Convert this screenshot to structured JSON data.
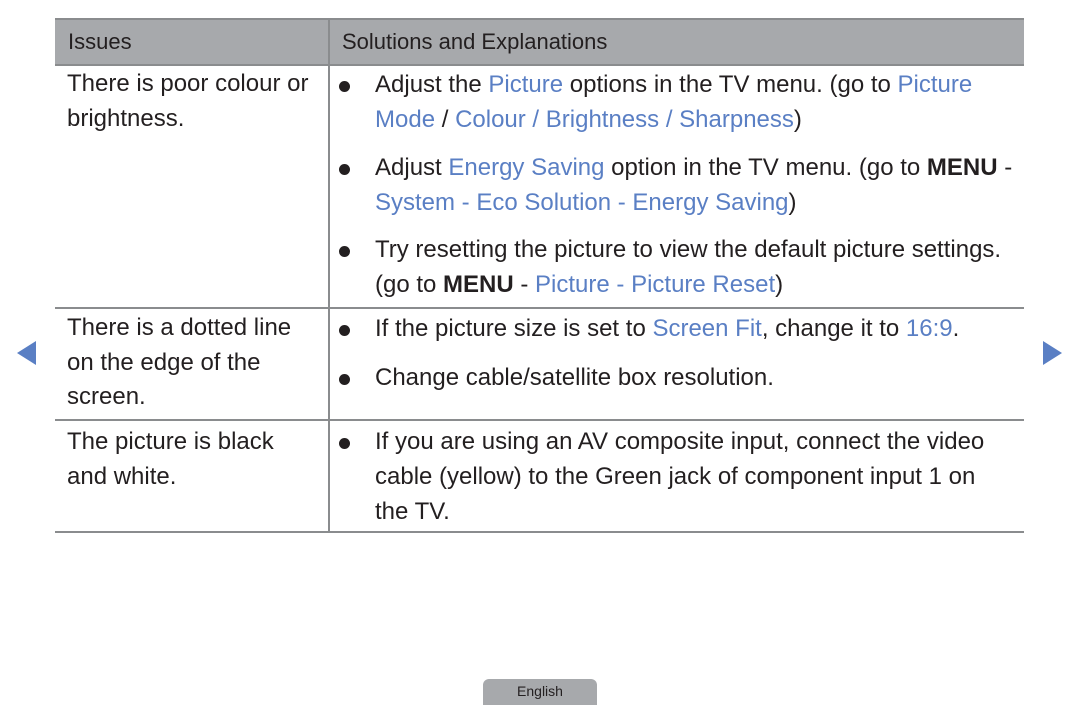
{
  "table": {
    "headers": [
      "Issues",
      "Solutions and Explanations"
    ],
    "rows": [
      {
        "issue": "There is poor colour or brightness.",
        "solutions": [
          [
            {
              "t": "Adjust the ",
              "s": "n"
            },
            {
              "t": "Picture",
              "s": "hl"
            },
            {
              "t": " options in the TV menu. (go to ",
              "s": "n"
            },
            {
              "t": "Picture Mode",
              "s": "hl"
            },
            {
              "t": " / ",
              "s": "n"
            },
            {
              "t": "Colour / Brightness / Sharpness",
              "s": "hl"
            },
            {
              "t": ")",
              "s": "n"
            }
          ],
          [
            {
              "t": "Adjust ",
              "s": "n"
            },
            {
              "t": "Energy Saving",
              "s": "hl"
            },
            {
              "t": " option in the TV menu. (go to ",
              "s": "n"
            },
            {
              "t": "MENU",
              "s": "b"
            },
            {
              "t": " - ",
              "s": "n"
            },
            {
              "t": "System - Eco Solution - Energy Saving",
              "s": "hl"
            },
            {
              "t": ")",
              "s": "n"
            }
          ],
          [
            {
              "t": "Try resetting the picture to view the default picture settings. (go to ",
              "s": "n"
            },
            {
              "t": "MENU",
              "s": "b"
            },
            {
              "t": " - ",
              "s": "n"
            },
            {
              "t": "Picture - Picture Reset",
              "s": "hl"
            },
            {
              "t": ")",
              "s": "n"
            }
          ]
        ]
      },
      {
        "issue": "There is a dotted line on the edge of the screen.",
        "solutions": [
          [
            {
              "t": "If the picture size is set to ",
              "s": "n"
            },
            {
              "t": "Screen Fit",
              "s": "hl"
            },
            {
              "t": ", change it to ",
              "s": "n"
            },
            {
              "t": "16:9",
              "s": "hl"
            },
            {
              "t": ".",
              "s": "n"
            }
          ],
          [
            {
              "t": "Change cable/satellite box resolution.",
              "s": "n"
            }
          ]
        ]
      },
      {
        "issue": "The picture is black and white.",
        "solutions": [
          [
            {
              "t": "If you are using an AV composite input, connect the video cable (yellow) to the Green jack of component input 1 on the TV.",
              "s": "n"
            }
          ]
        ]
      }
    ]
  },
  "navigation": {
    "prev_icon": "left-triangle-arrow",
    "next_icon": "right-triangle-arrow"
  },
  "footer": {
    "language_tab": "English"
  },
  "colors": {
    "highlight": "#5a7fc4",
    "header_bg": "#a7a9ac"
  }
}
